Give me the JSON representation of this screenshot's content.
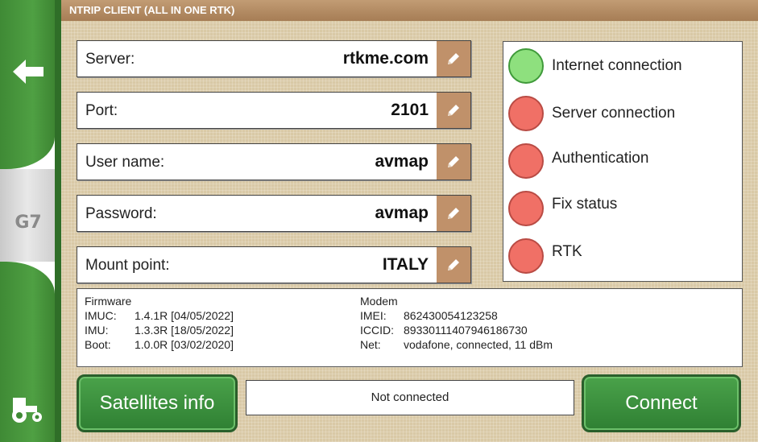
{
  "window": {
    "title": "NTRIP CLIENT (ALL IN ONE RTK)"
  },
  "sidebar": {
    "back_icon": "back-arrow-icon",
    "logo_text": "G7",
    "tractor_icon": "tractor-icon"
  },
  "fields": [
    {
      "label": "Server:",
      "value": "rtkme.com"
    },
    {
      "label": "Port:",
      "value": "2101"
    },
    {
      "label": "User name:",
      "value": "avmap"
    },
    {
      "label": "Password:",
      "value": "avmap"
    },
    {
      "label": "Mount point:",
      "value": "ITALY"
    }
  ],
  "status": [
    {
      "label": "Internet connection",
      "state": "ok",
      "color": "#8ee07e"
    },
    {
      "label": "Server connection",
      "state": "error",
      "color": "#f07066"
    },
    {
      "label": "Authentication",
      "state": "error",
      "color": "#f07066"
    },
    {
      "label": "Fix status",
      "state": "error",
      "color": "#f07066"
    },
    {
      "label": "RTK",
      "state": "error",
      "color": "#f07066"
    }
  ],
  "firmware": {
    "heading": "Firmware",
    "rows": [
      {
        "key": "IMUC:",
        "value": "1.4.1R [04/05/2022]"
      },
      {
        "key": "IMU:",
        "value": "1.3.3R [18/05/2022]"
      },
      {
        "key": "Boot:",
        "value": "1.0.0R [03/02/2020]"
      }
    ]
  },
  "modem": {
    "heading": "Modem",
    "rows": [
      {
        "key": "IMEI:",
        "value": "862430054123258"
      },
      {
        "key": "ICCID:",
        "value": "89330111407946186730"
      },
      {
        "key": "Net:",
        "value": "vodafone, connected, 11 dBm"
      }
    ]
  },
  "footer": {
    "satellites_label": "Satellites info",
    "connection_status": "Not connected",
    "connect_label": "Connect"
  },
  "colors": {
    "accent_green": "#3f8a35",
    "title_bar": "#a67d55",
    "edit_button": "#c0916a",
    "background": "#d9c9a6"
  }
}
